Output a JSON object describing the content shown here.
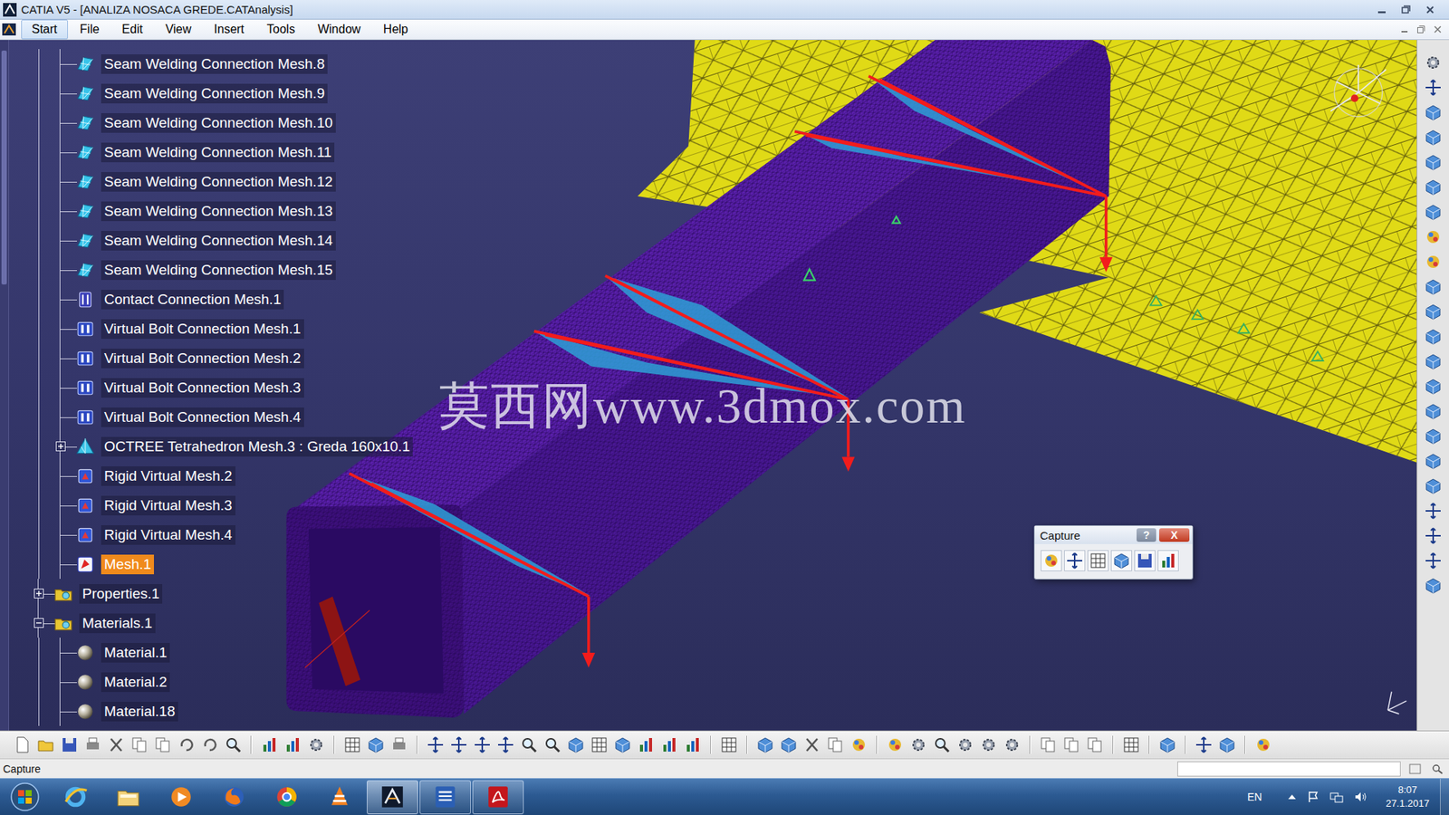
{
  "window": {
    "title": "CATIA V5 - [ANALIZA NOSACA GREDE.CATAnalysis]"
  },
  "menu": [
    {
      "label": "Start",
      "selected": true
    },
    {
      "label": "File",
      "selected": false
    },
    {
      "label": "Edit",
      "selected": false
    },
    {
      "label": "View",
      "selected": false
    },
    {
      "label": "Insert",
      "selected": false
    },
    {
      "label": "Tools",
      "selected": false
    },
    {
      "label": "Window",
      "selected": false
    },
    {
      "label": "Help",
      "selected": false
    }
  ],
  "tree": {
    "mesh_nodes": [
      {
        "label": "Seam Welding Connection Mesh.8",
        "kind": "seam",
        "selected": false
      },
      {
        "label": "Seam Welding Connection Mesh.9",
        "kind": "seam",
        "selected": false
      },
      {
        "label": "Seam Welding Connection Mesh.10",
        "kind": "seam",
        "selected": false
      },
      {
        "label": "Seam Welding Connection Mesh.11",
        "kind": "seam",
        "selected": false
      },
      {
        "label": "Seam Welding Connection Mesh.12",
        "kind": "seam",
        "selected": false
      },
      {
        "label": "Seam Welding Connection Mesh.13",
        "kind": "seam",
        "selected": false
      },
      {
        "label": "Seam Welding Connection Mesh.14",
        "kind": "seam",
        "selected": false
      },
      {
        "label": "Seam Welding Connection Mesh.15",
        "kind": "seam",
        "selected": false
      },
      {
        "label": "Contact Connection Mesh.1",
        "kind": "contact",
        "selected": false
      },
      {
        "label": "Virtual Bolt Connection Mesh.1",
        "kind": "bolt",
        "selected": false
      },
      {
        "label": "Virtual Bolt Connection Mesh.2",
        "kind": "bolt",
        "selected": false
      },
      {
        "label": "Virtual Bolt Connection Mesh.3",
        "kind": "bolt",
        "selected": false
      },
      {
        "label": "Virtual Bolt Connection Mesh.4",
        "kind": "bolt",
        "selected": false
      },
      {
        "label": "OCTREE Tetrahedron Mesh.3 : Greda 160x10.1",
        "kind": "octree",
        "selected": false,
        "expanded": false
      },
      {
        "label": "Rigid Virtual Mesh.2",
        "kind": "rigid",
        "selected": false
      },
      {
        "label": "Rigid Virtual Mesh.3",
        "kind": "rigid",
        "selected": false
      },
      {
        "label": "Rigid Virtual Mesh.4",
        "kind": "rigid",
        "selected": false
      },
      {
        "label": "Mesh.1",
        "kind": "mesh",
        "selected": true
      }
    ],
    "sets": [
      {
        "label": "Properties.1",
        "kind": "set",
        "selected": false,
        "expanded": false,
        "children": []
      },
      {
        "label": "Materials.1",
        "kind": "set",
        "selected": false,
        "expanded": true,
        "children": [
          {
            "label": "Material.1",
            "kind": "material",
            "selected": false
          },
          {
            "label": "Material.2",
            "kind": "material",
            "selected": false
          },
          {
            "label": "Material.18",
            "kind": "material",
            "selected": false
          }
        ]
      }
    ]
  },
  "watermark": "莫西网www.3dmox.com",
  "capture_dialog": {
    "title": "Capture",
    "help": "?",
    "close": "X"
  },
  "status_bar": {
    "text": "Capture"
  },
  "taskbar": {
    "apps": [
      {
        "kind": "ie",
        "selected": false,
        "open": false
      },
      {
        "kind": "explorer",
        "selected": false,
        "open": false
      },
      {
        "kind": "media",
        "selected": false,
        "open": false
      },
      {
        "kind": "firefox",
        "selected": false,
        "open": false
      },
      {
        "kind": "chrome",
        "selected": false,
        "open": false
      },
      {
        "kind": "vlc",
        "selected": false,
        "open": false
      },
      {
        "kind": "catia",
        "selected": true,
        "open": true
      },
      {
        "kind": "word",
        "selected": false,
        "open": true
      },
      {
        "kind": "acrobat",
        "selected": false,
        "open": true
      }
    ],
    "language": "EN",
    "time": "8:07",
    "date": "27.1.2017"
  }
}
